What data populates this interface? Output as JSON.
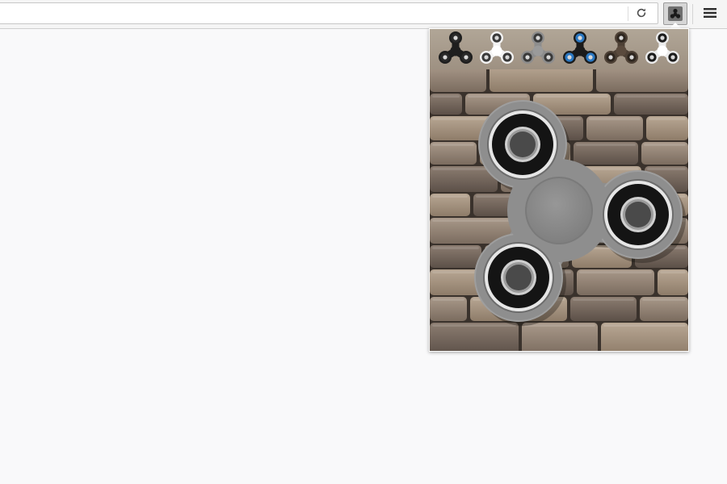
{
  "toolbar": {
    "reload_icon": "reload-icon",
    "extension_icon": "fidget-spinner-extension-icon",
    "menu_icon": "hamburger-menu-icon"
  },
  "popup": {
    "chooser": [
      {
        "style": "black",
        "body_color": "#1e1e1e",
        "ring_color": "#2a2a2a",
        "center_color": "#1e1e1e"
      },
      {
        "style": "white",
        "body_color": "#f4f4f4",
        "ring_color": "#3a3a3a",
        "center_color": "#ffffff"
      },
      {
        "style": "gray",
        "body_color": "#8d8d8d",
        "ring_color": "#3a3a3a",
        "center_color": "#9a9a9a"
      },
      {
        "style": "blue",
        "body_color": "#1b1b1b",
        "ring_color": "#2b78c2",
        "center_color": "#1b1b1b"
      },
      {
        "style": "bronze",
        "body_color": "#4d4035",
        "ring_color": "#2e261f",
        "center_color": "#5a4a3d"
      },
      {
        "style": "silver",
        "body_color": "#ececec",
        "ring_color": "#1c1c1c",
        "center_color": "#ffffff"
      }
    ],
    "selected": "gray",
    "stage": {
      "background": "stone-wall",
      "spinner_body_color": "#8e8e8e",
      "spinner_center_color": "#8a8a8a",
      "bearing_color": "#141414",
      "bearing_ring_color": "#cfcfcf"
    }
  }
}
